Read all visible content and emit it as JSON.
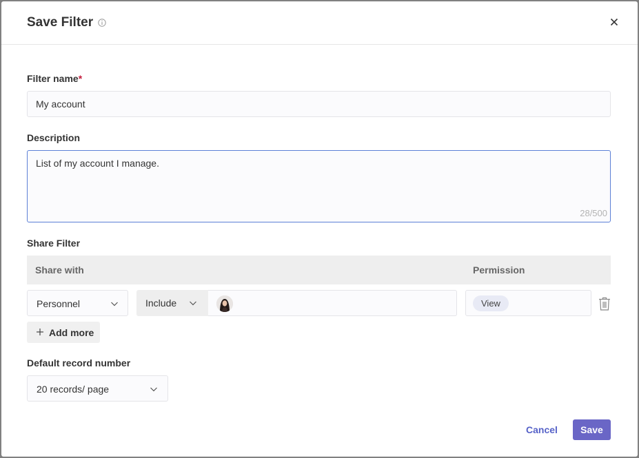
{
  "dialog": {
    "title": "Save Filter",
    "close_icon": "close-icon",
    "info_icon": "info-icon"
  },
  "filter_name": {
    "label": "Filter name",
    "required_mark": "*",
    "value": "My account"
  },
  "description": {
    "label": "Description",
    "value": "List of my account I manage.",
    "counter": "28/500"
  },
  "share_filter": {
    "label": "Share Filter",
    "columns": {
      "share_with": "Share with",
      "permission": "Permission"
    },
    "rows": [
      {
        "type": "Personnel",
        "mode": "Include",
        "avatar_icon": "user-avatar",
        "permission": "View"
      }
    ],
    "add_more_label": "Add more"
  },
  "default_record_number": {
    "label": "Default record number",
    "value": "20 records/ page"
  },
  "footer": {
    "cancel_label": "Cancel",
    "save_label": "Save"
  },
  "colors": {
    "primary": "#6a66c6",
    "link": "#5662c8",
    "required": "#c41d3d",
    "focus_border": "#5b7fd6"
  }
}
